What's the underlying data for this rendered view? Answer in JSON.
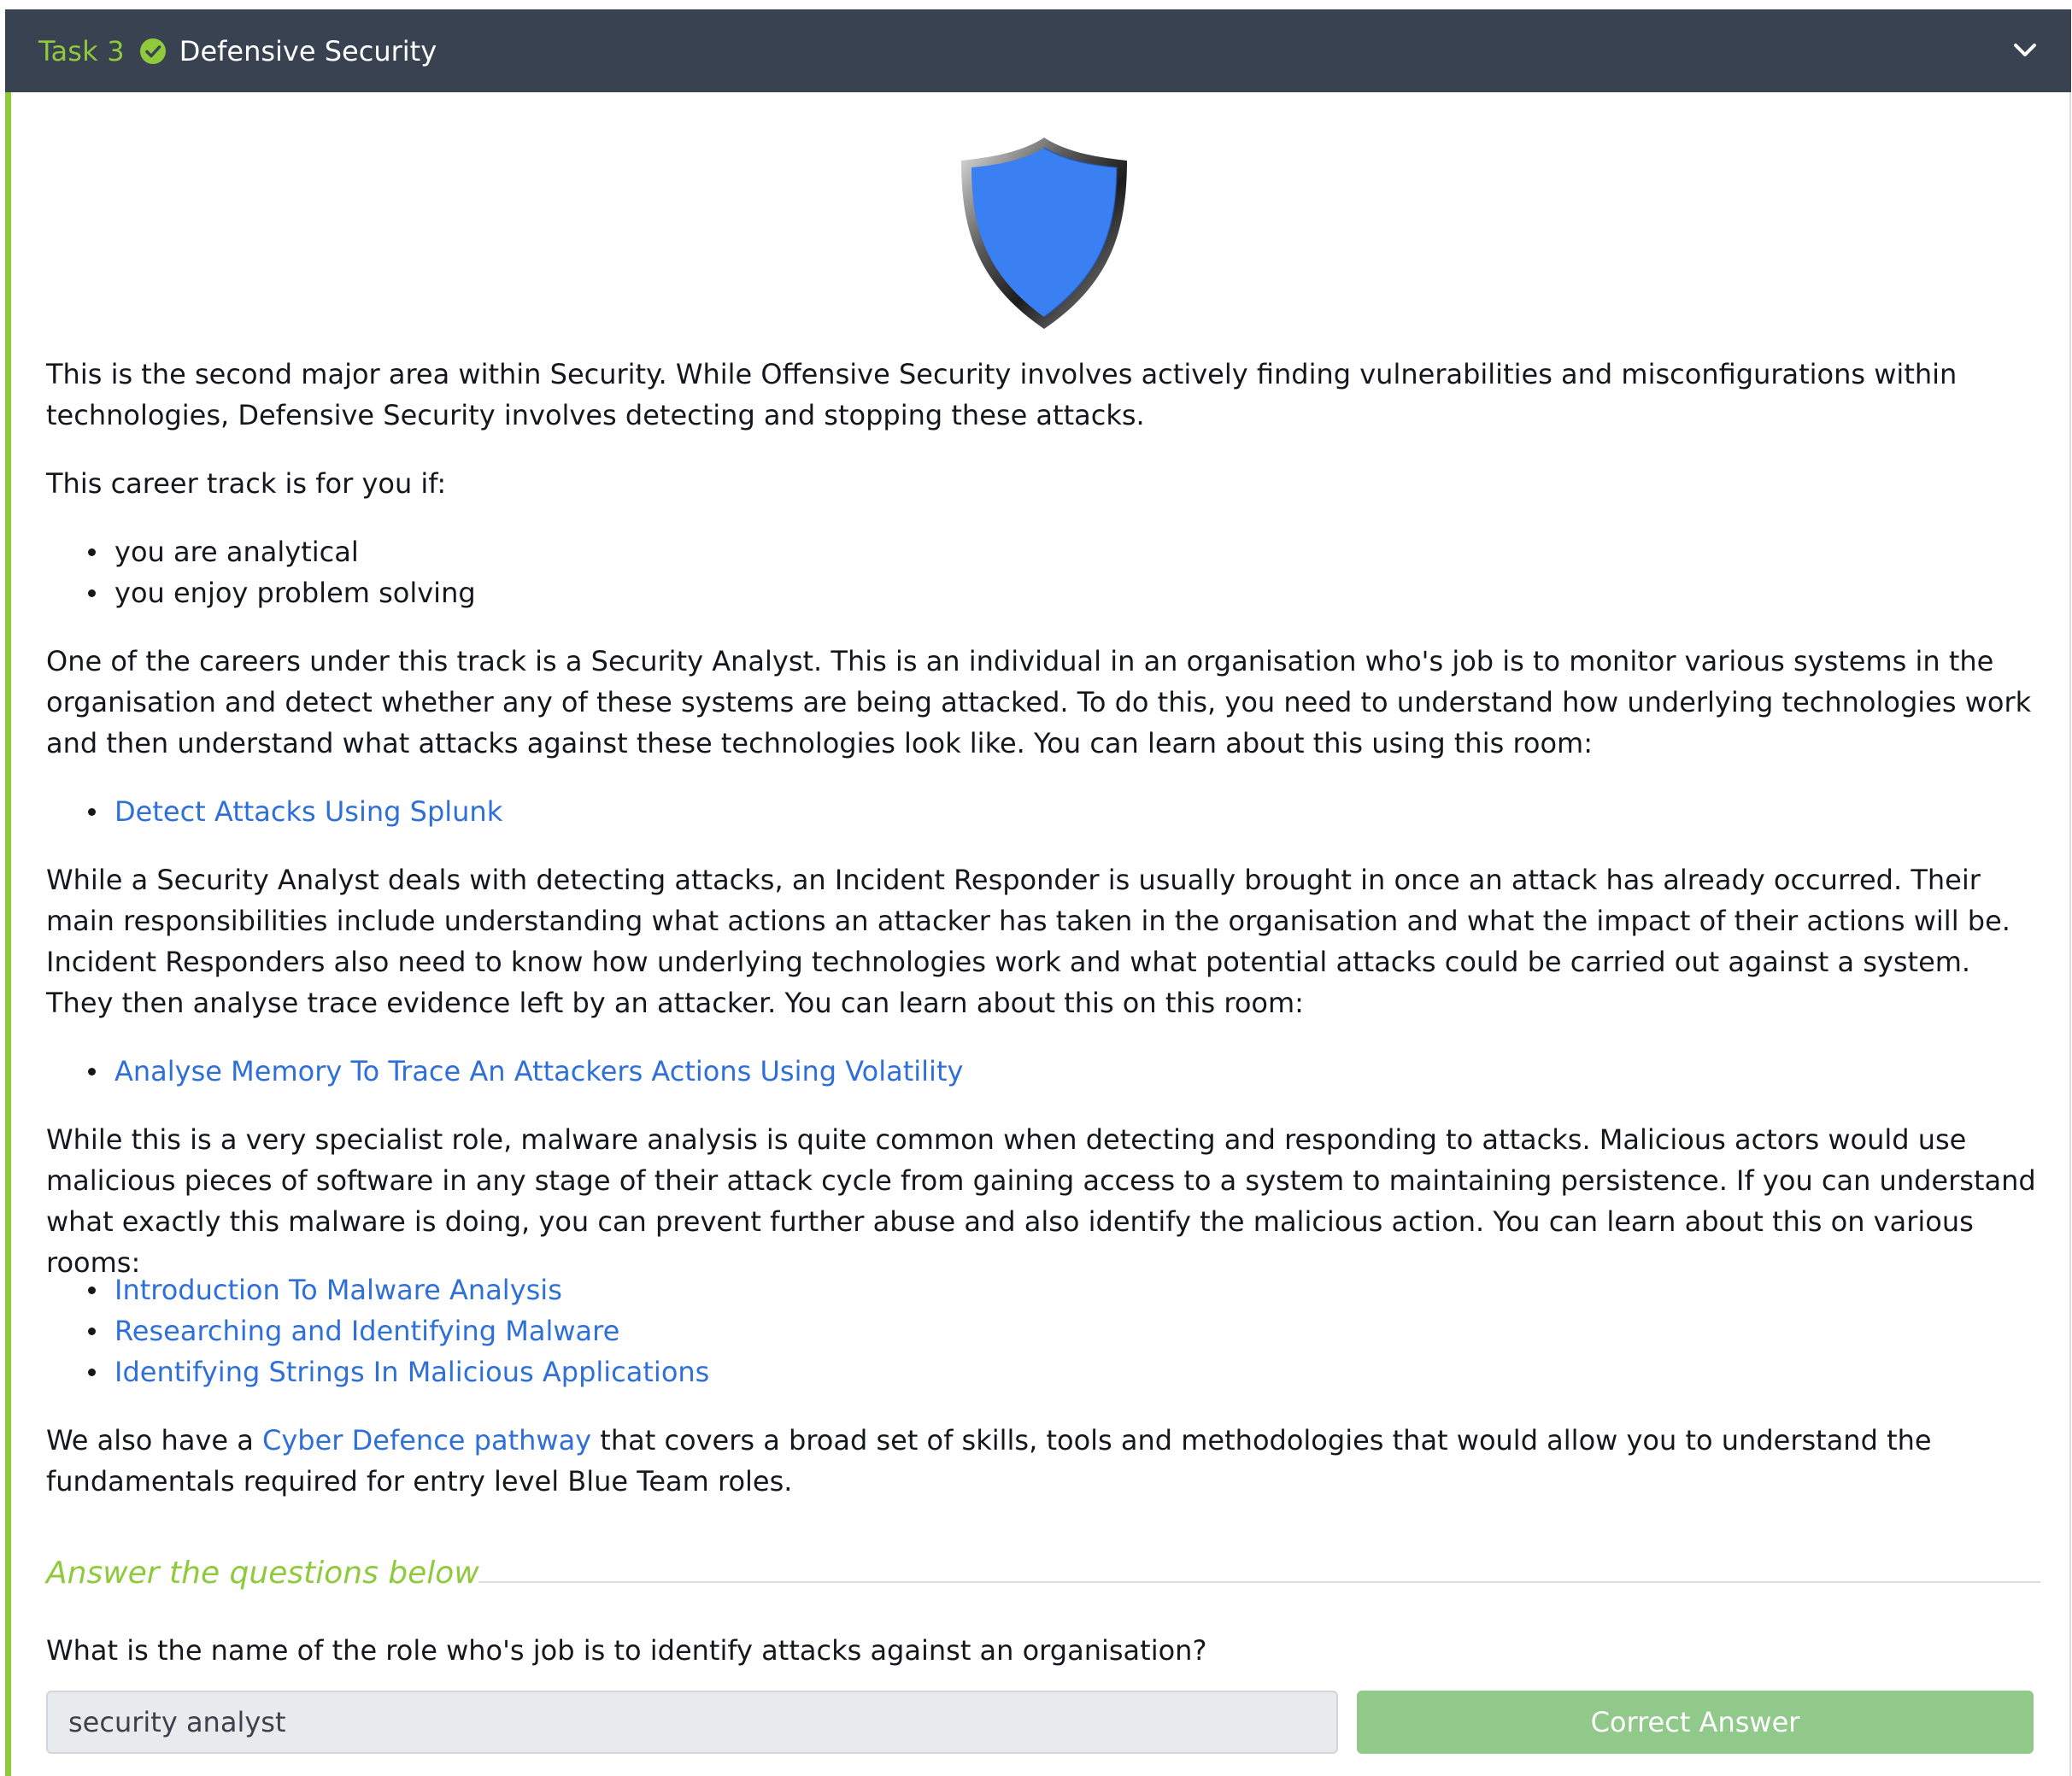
{
  "task": {
    "number_label": "Task 3",
    "title": "Defensive Security",
    "status_icon": "check-circle-icon",
    "toggle_icon": "chevron-down-icon"
  },
  "content": {
    "image_icon": "shield-icon",
    "intro": "This is the second major area within Security. While Offensive Security involves actively finding vulnerabilities and misconfigurations within technologies, Defensive Security involves detecting and stopping these attacks.",
    "career_track_intro": "This career track is for you if:",
    "traits": [
      "you are analytical",
      "you enjoy problem solving"
    ],
    "analyst_paragraph": "One of the careers under this track is a Security Analyst. This is an individual in an organisation who's job is to monitor various systems in the organisation and detect whether any of these systems are being attacked. To do this, you need to understand how underlying technologies work and then understand what attacks against these technologies look like. You can learn about this using this room:",
    "analyst_links": [
      "Detect Attacks Using Splunk"
    ],
    "responder_paragraph": "While a Security Analyst deals with detecting attacks, an Incident Responder is usually brought in once an attack has already occurred. Their main responsibilities include understanding what actions an attacker has taken in the organisation and what the impact of their actions will be. Incident Responders also need to know how underlying technologies work and what potential attacks could be carried out against a system. They then analyse trace evidence left by an attacker. You can learn about this on this room:",
    "responder_links": [
      "Analyse Memory To Trace An Attackers Actions Using Volatility"
    ],
    "malware_paragraph": "While this is a very specialist role, malware analysis is quite common when detecting and responding to attacks. Malicious actors would use malicious pieces of software in any stage of their attack cycle from gaining access to a system to maintaining persistence. If you can understand what exactly this malware is doing, you can prevent further abuse and also identify the malicious action. You can learn about this on various rooms:",
    "malware_links": [
      "Introduction To Malware Analysis",
      "Researching and Identifying Malware",
      "Identifying Strings In Malicious Applications"
    ],
    "pathway_prefix": "We also have a ",
    "pathway_link": "Cyber Defence pathway",
    "pathway_suffix": " that covers a broad set of skills, tools and methodologies that would allow you to understand the fundamentals required for entry level Blue Team roles."
  },
  "questions": {
    "heading": "Answer the questions below",
    "items": [
      {
        "question": "What is the name of the role who's job is to identify attacks against an organisation?",
        "answer_value": "security analyst",
        "button_label": "Correct Answer"
      }
    ]
  },
  "colors": {
    "header_bg": "#394250",
    "accent_green": "#8fc93c",
    "link_blue": "#2e6fd8",
    "shield_blue": "#3b80f3",
    "correct_button": "#91c98b"
  }
}
